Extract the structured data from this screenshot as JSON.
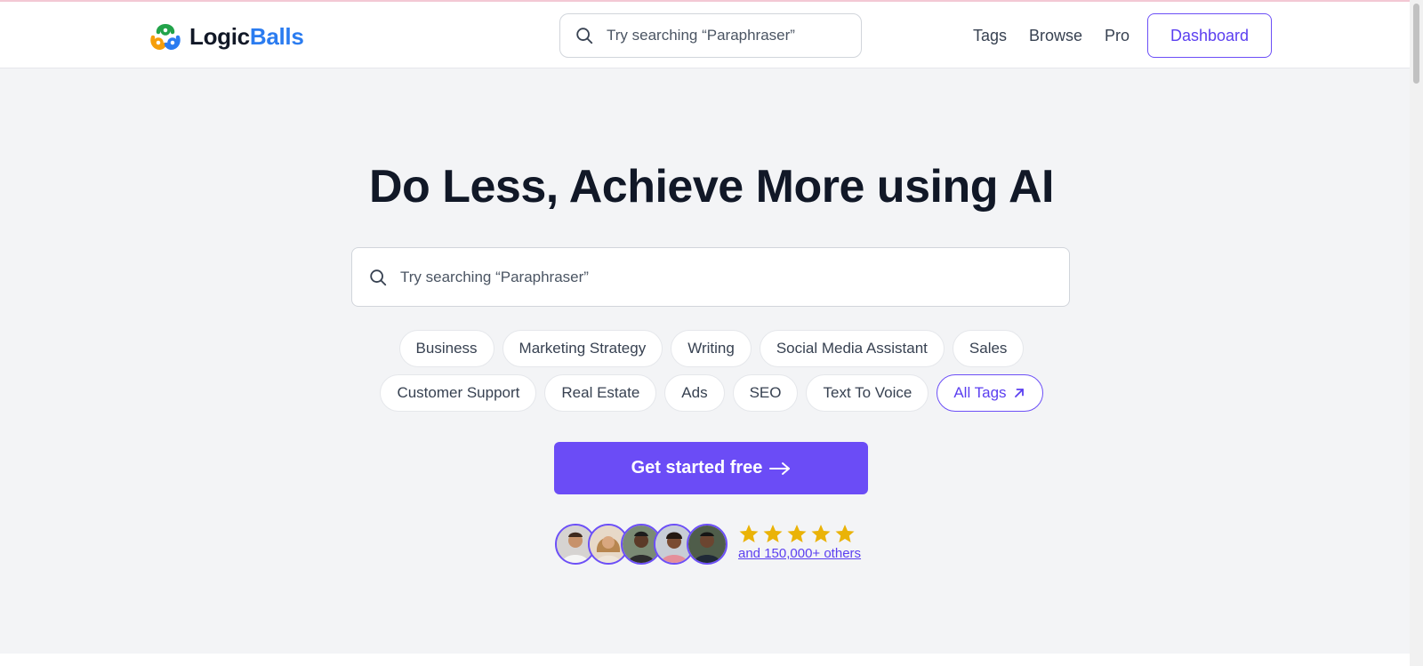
{
  "brand": {
    "part1": "Logic",
    "part2": "Balls",
    "color_dark": "#111827",
    "color_blue": "#2b7cf0"
  },
  "header": {
    "search_placeholder": "Try searching “Paraphraser”",
    "nav": {
      "tags": "Tags",
      "browse": "Browse",
      "pro": "Pro"
    },
    "dashboard_label": "Dashboard"
  },
  "hero": {
    "headline": "Do Less, Achieve More using AI",
    "search_placeholder": "Try searching “Paraphraser”",
    "tags_row1": [
      "Business",
      "Marketing Strategy",
      "Writing",
      "Social Media Assistant",
      "Sales"
    ],
    "tags_row2": [
      "Customer Support",
      "Real Estate",
      "Ads",
      "SEO",
      "Text To Voice"
    ],
    "all_tags_label": "All Tags",
    "cta_label": "Get started free",
    "rating_stars": 5,
    "social_proof": "and 150,000+ others"
  },
  "icons": {
    "search": "search-icon",
    "arrow_right": "arrow-right-icon",
    "arrow_up_right": "arrow-up-right-icon",
    "star": "star-icon"
  },
  "colors": {
    "accent": "#6b4cf6",
    "accent_text": "#5b3ff0",
    "star": "#eab308",
    "hero_bg": "#f3f4f6"
  }
}
